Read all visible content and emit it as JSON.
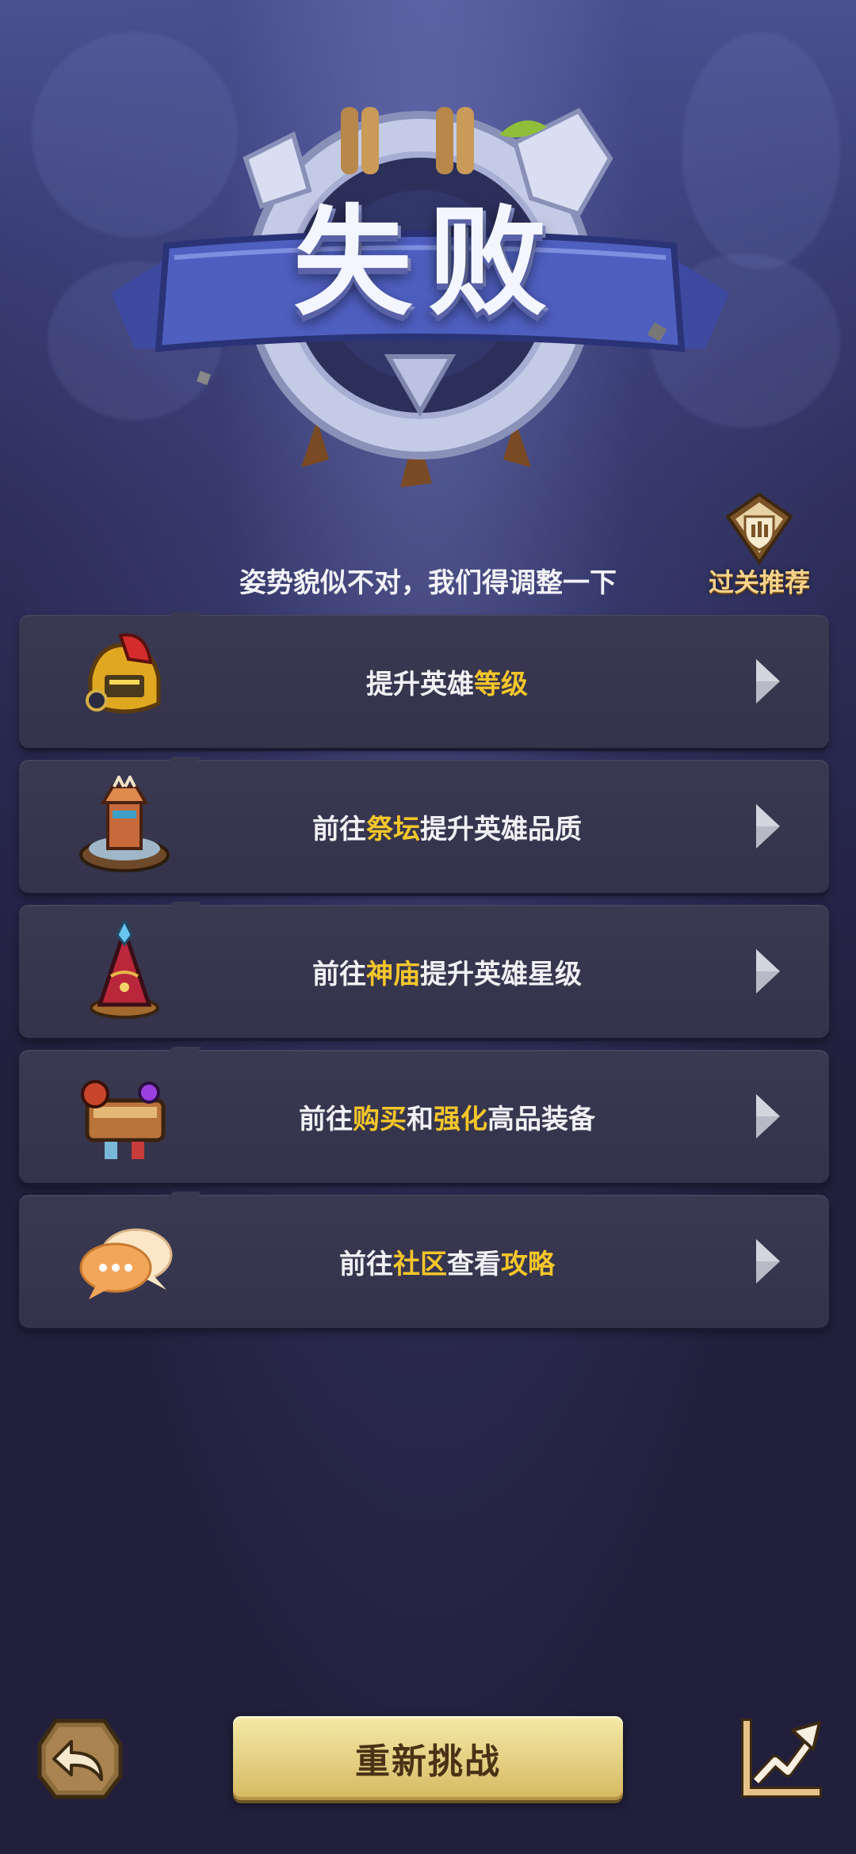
{
  "header": {
    "title": "失败",
    "subtitle": "姿势貌似不对，我们得调整一下",
    "recommend_label": "过关推荐"
  },
  "suggestions": [
    {
      "icon": "helmet-icon",
      "parts": [
        "提升英雄",
        "等级",
        ""
      ]
    },
    {
      "icon": "altar-icon",
      "parts": [
        "前往",
        "祭坛",
        "提升英雄品质"
      ]
    },
    {
      "icon": "temple-icon",
      "parts": [
        "前往",
        "神庙",
        "提升英雄星级"
      ]
    },
    {
      "icon": "equipment-icon",
      "parts_multi": [
        [
          "前往",
          false
        ],
        [
          "购买",
          true
        ],
        [
          "和",
          false
        ],
        [
          "强化",
          true
        ],
        [
          "高品装备",
          false
        ]
      ]
    },
    {
      "icon": "chat-bubble-icon",
      "parts_multi": [
        [
          "前往",
          false
        ],
        [
          "社区",
          true
        ],
        [
          "查看",
          false
        ],
        [
          "攻略",
          true
        ]
      ]
    }
  ],
  "footer": {
    "retry_label": "重新挑战",
    "back_icon": "back-arrow-icon",
    "trend_icon": "trend-chart-icon"
  },
  "colors": {
    "highlight": "#f5c62a",
    "card_bg": "#3a3952",
    "page_bg": "#211f3b",
    "retry_bg": "#e7d489"
  }
}
